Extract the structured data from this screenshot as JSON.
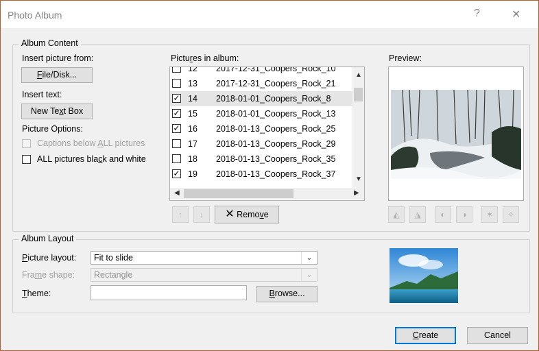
{
  "window": {
    "title": "Photo Album",
    "help_glyph": "?",
    "close_glyph": "✕"
  },
  "album_content": {
    "legend": "Album Content",
    "insert_picture_label": "Insert picture from:",
    "file_disk_button": "File/Disk...",
    "insert_text_label": "Insert text:",
    "new_text_box_button": "New Text Box",
    "picture_options_label": "Picture Options:",
    "captions_option": {
      "label": "Captions below ALL pictures",
      "checked": false,
      "enabled": false
    },
    "black_white_option": {
      "label": "ALL pictures black and white",
      "checked": false,
      "enabled": true
    },
    "pictures_label": "Pictures in album:",
    "pictures": [
      {
        "num": "12",
        "name": "2017-12-31_Coopers_Rock_10",
        "checked": false
      },
      {
        "num": "13",
        "name": "2017-12-31_Coopers_Rock_21",
        "checked": false
      },
      {
        "num": "14",
        "name": "2018-01-01_Coopers_Rock_8",
        "checked": true,
        "selected": true
      },
      {
        "num": "15",
        "name": "2018-01-01_Coopers_Rock_13",
        "checked": true
      },
      {
        "num": "16",
        "name": "2018-01-13_Coopers_Rock_25",
        "checked": true
      },
      {
        "num": "17",
        "name": "2018-01-13_Coopers_Rock_29",
        "checked": false
      },
      {
        "num": "18",
        "name": "2018-01-13_Coopers_Rock_35",
        "checked": false
      },
      {
        "num": "19",
        "name": "2018-01-13_Coopers_Rock_37",
        "checked": true
      }
    ],
    "move_up_icon": "↑",
    "move_down_icon": "↓",
    "remove_button": "Remove",
    "preview_label": "Preview:"
  },
  "album_layout": {
    "legend": "Album Layout",
    "picture_layout_label": "Picture layout:",
    "picture_layout_value": "Fit to slide",
    "frame_shape_label": "Frame shape:",
    "frame_shape_value": "Rectangle",
    "theme_label": "Theme:",
    "theme_value": "",
    "browse_button": "Browse..."
  },
  "footer": {
    "create_button": "Create",
    "cancel_button": "Cancel"
  },
  "colors": {
    "accent": "#0078d7",
    "border": "#b65c2d"
  }
}
